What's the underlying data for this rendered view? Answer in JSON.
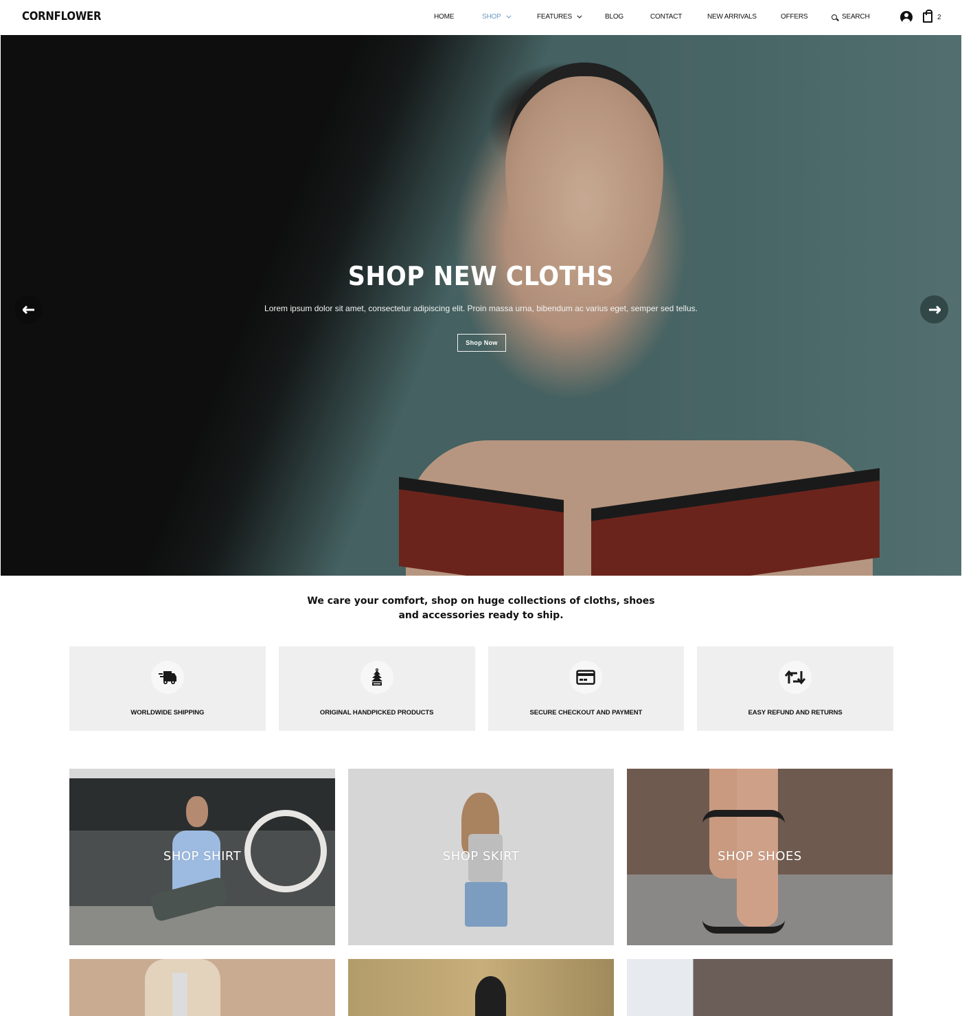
{
  "header": {
    "logo": "CORNFLOWER",
    "nav": [
      {
        "label": "HOME",
        "active": false,
        "dropdown": false
      },
      {
        "label": "SHOP",
        "active": true,
        "dropdown": true
      },
      {
        "label": "FEATURES",
        "active": false,
        "dropdown": true
      },
      {
        "label": "BLOG",
        "active": false,
        "dropdown": false
      },
      {
        "label": "CONTACT",
        "active": false,
        "dropdown": false
      },
      {
        "label": "NEW ARRIVALS",
        "active": false,
        "dropdown": false
      },
      {
        "label": "OFFERS",
        "active": false,
        "dropdown": false
      },
      {
        "label": "SEARCH",
        "active": false,
        "dropdown": false,
        "icon": "search-icon"
      }
    ],
    "account_icon": "user-circle-icon",
    "cart_icon": "shopping-bag-icon",
    "cart_count": "2",
    "active_color": "#6d9ac4"
  },
  "hero": {
    "title": "SHOP NEW CLOTHS",
    "subtitle": "Lorem ipsum dolor sit amet, consectetur adipiscing elit. Proin massa urna, bibendum ac varius eget, semper sed tellus.",
    "cta_label": "Shop Now",
    "prev_icon": "arrow-left-icon",
    "next_icon": "arrow-right-icon",
    "prev_glyph": "🠔",
    "next_glyph": "🠖"
  },
  "tagline": {
    "line1": "We care your comfort, shop on huge collections of cloths, shoes",
    "line2": "and accessories ready to ship."
  },
  "features": [
    {
      "label": "WORLDWIDE SHIPPING",
      "icon": "shipping-truck-icon"
    },
    {
      "label": "ORIGINAL HANDPICKED PRODUCTS",
      "icon": "tree-air-freshener-icon"
    },
    {
      "label": "SECURE CHECKOUT AND PAYMENT",
      "icon": "credit-card-icon"
    },
    {
      "label": "EASY REFUND AND RETURNS",
      "icon": "retweet-arrows-icon"
    }
  ],
  "categories": [
    {
      "label": "SHOP SHIRT"
    },
    {
      "label": "SHOP SKIRT"
    },
    {
      "label": "SHOP SHOES"
    },
    {
      "label": ""
    },
    {
      "label": ""
    },
    {
      "label": ""
    }
  ]
}
